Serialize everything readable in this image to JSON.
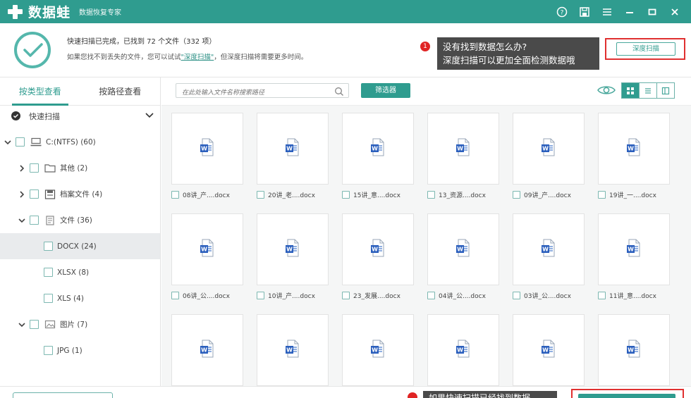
{
  "titlebar": {
    "app_name": "数据蛙",
    "subtitle": "数据恢复专家",
    "controls": [
      "help-icon",
      "save-icon",
      "menu-icon",
      "minimize-icon",
      "maximize-icon",
      "close-icon"
    ]
  },
  "status": {
    "line1": "快速扫描已完成，已找到 72 个文件（332 项）",
    "line2_prefix": "如果您找不到丢失的文件，您可以试试",
    "line2_link": "\"深度扫描\"",
    "line2_suffix": "，但深度扫描将需要更多时间。"
  },
  "tips": {
    "badge1": "1",
    "tip1_line1": "没有找到数据怎么办?",
    "tip1_line2": "深度扫描可以更加全面检测数据哦",
    "bottom_tip": "如果快速扫描已经找到数据"
  },
  "deep_scan_button": "深度扫描",
  "sidebar": {
    "tabs": [
      "按类型查看",
      "按路径查看"
    ],
    "active_tab": 0,
    "quick_scan": "快速扫描",
    "tree": [
      {
        "label": "C:(NTFS) (60)",
        "level": 0,
        "chevron": "down",
        "icon": "drive-icon"
      },
      {
        "label": "其他 (2)",
        "level": 1,
        "chevron": "right",
        "icon": "folder-icon"
      },
      {
        "label": "档案文件 (4)",
        "level": 1,
        "chevron": "right",
        "icon": "archive-icon"
      },
      {
        "label": "文件 (36)",
        "level": 1,
        "chevron": "down",
        "icon": "document-icon"
      },
      {
        "label": "DOCX (24)",
        "level": 2,
        "chevron": "",
        "icon": "",
        "selected": true
      },
      {
        "label": "XLSX (8)",
        "level": 2,
        "chevron": "",
        "icon": ""
      },
      {
        "label": "XLS (4)",
        "level": 2,
        "chevron": "",
        "icon": ""
      },
      {
        "label": "图片 (7)",
        "level": 1,
        "chevron": "down",
        "icon": "image-icon"
      },
      {
        "label": "JPG (1)",
        "level": 2,
        "chevron": "",
        "icon": ""
      }
    ]
  },
  "toolbar": {
    "search_placeholder": "在此处输入文件名称搜索路径",
    "filter_label": "筛选器",
    "active_view": 0
  },
  "files": [
    "08讲_产....docx",
    "20讲_老....docx",
    "15讲_意....docx",
    "13_资源....docx",
    "09讲_产....docx",
    "19讲_一....docx",
    "06讲_公....docx",
    "10讲_产....docx",
    "23_发展....docx",
    "04讲_公....docx",
    "03讲_公....docx",
    "11讲_意....docx",
    "",
    "",
    "",
    "",
    "",
    ""
  ],
  "colors": {
    "brand": "#2f9c8f",
    "highlight": "#e03030",
    "tip_bg": "#4a4a4a"
  }
}
